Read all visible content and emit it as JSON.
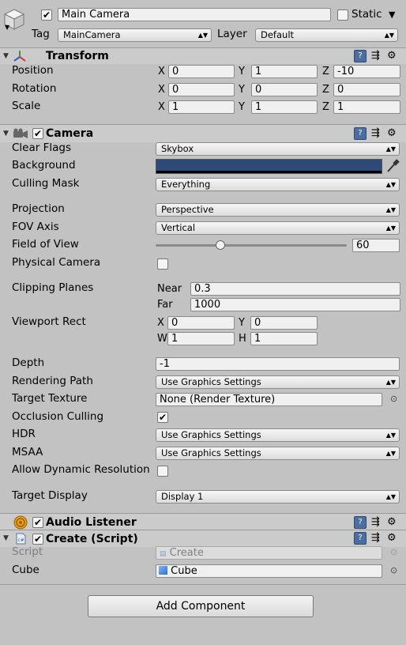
{
  "object": {
    "name": "Main Camera",
    "static_label": "Static",
    "tag_label": "Tag",
    "tag_value": "MainCamera",
    "layer_label": "Layer",
    "layer_value": "Default"
  },
  "transform": {
    "title": "Transform",
    "position": {
      "label": "Position",
      "x": "0",
      "y": "1",
      "z": "-10"
    },
    "rotation": {
      "label": "Rotation",
      "x": "0",
      "y": "0",
      "z": "0"
    },
    "scale": {
      "label": "Scale",
      "x": "1",
      "y": "1",
      "z": "1"
    },
    "axis_x": "X",
    "axis_y": "Y",
    "axis_z": "Z"
  },
  "camera": {
    "title": "Camera",
    "clear_flags": {
      "label": "Clear Flags",
      "value": "Skybox"
    },
    "background": {
      "label": "Background",
      "color": "#2d4a78"
    },
    "culling_mask": {
      "label": "Culling Mask",
      "value": "Everything"
    },
    "projection": {
      "label": "Projection",
      "value": "Perspective"
    },
    "fov_axis": {
      "label": "FOV Axis",
      "value": "Vertical"
    },
    "field_of_view": {
      "label": "Field of View",
      "value": "60",
      "min": 1,
      "max": 179
    },
    "physical_camera": {
      "label": "Physical Camera",
      "checked": false
    },
    "clipping": {
      "label": "Clipping Planes",
      "near_label": "Near",
      "near": "0.3",
      "far_label": "Far",
      "far": "1000"
    },
    "viewport": {
      "label": "Viewport Rect",
      "x_label": "X",
      "x": "0",
      "y_label": "Y",
      "y": "0",
      "w_label": "W",
      "w": "1",
      "h_label": "H",
      "h": "1"
    },
    "depth": {
      "label": "Depth",
      "value": "-1"
    },
    "rendering_path": {
      "label": "Rendering Path",
      "value": "Use Graphics Settings"
    },
    "target_texture": {
      "label": "Target Texture",
      "value": "None (Render Texture)"
    },
    "occlusion_culling": {
      "label": "Occlusion Culling",
      "checked": true
    },
    "hdr": {
      "label": "HDR",
      "value": "Use Graphics Settings"
    },
    "msaa": {
      "label": "MSAA",
      "value": "Use Graphics Settings"
    },
    "dynamic_resolution": {
      "label": "Allow Dynamic Resolution",
      "checked": false
    },
    "target_display": {
      "label": "Target Display",
      "value": "Display 1"
    }
  },
  "audio_listener": {
    "title": "Audio Listener"
  },
  "script": {
    "title": "Create (Script)",
    "script_label": "Script",
    "script_value": "Create",
    "cube_label": "Cube",
    "cube_value": "Cube"
  },
  "add_component": "Add Component",
  "colors": {
    "panel": "#c2c2c2",
    "header": "#cbcbcb",
    "accent": "#4a6fa0"
  },
  "icons": [
    "cube-icon",
    "transform-icon",
    "camera-icon",
    "audio-listener-icon",
    "script-icon",
    "help-icon",
    "presets-icon",
    "gear-icon",
    "eyedropper-icon",
    "object-picker-icon"
  ]
}
